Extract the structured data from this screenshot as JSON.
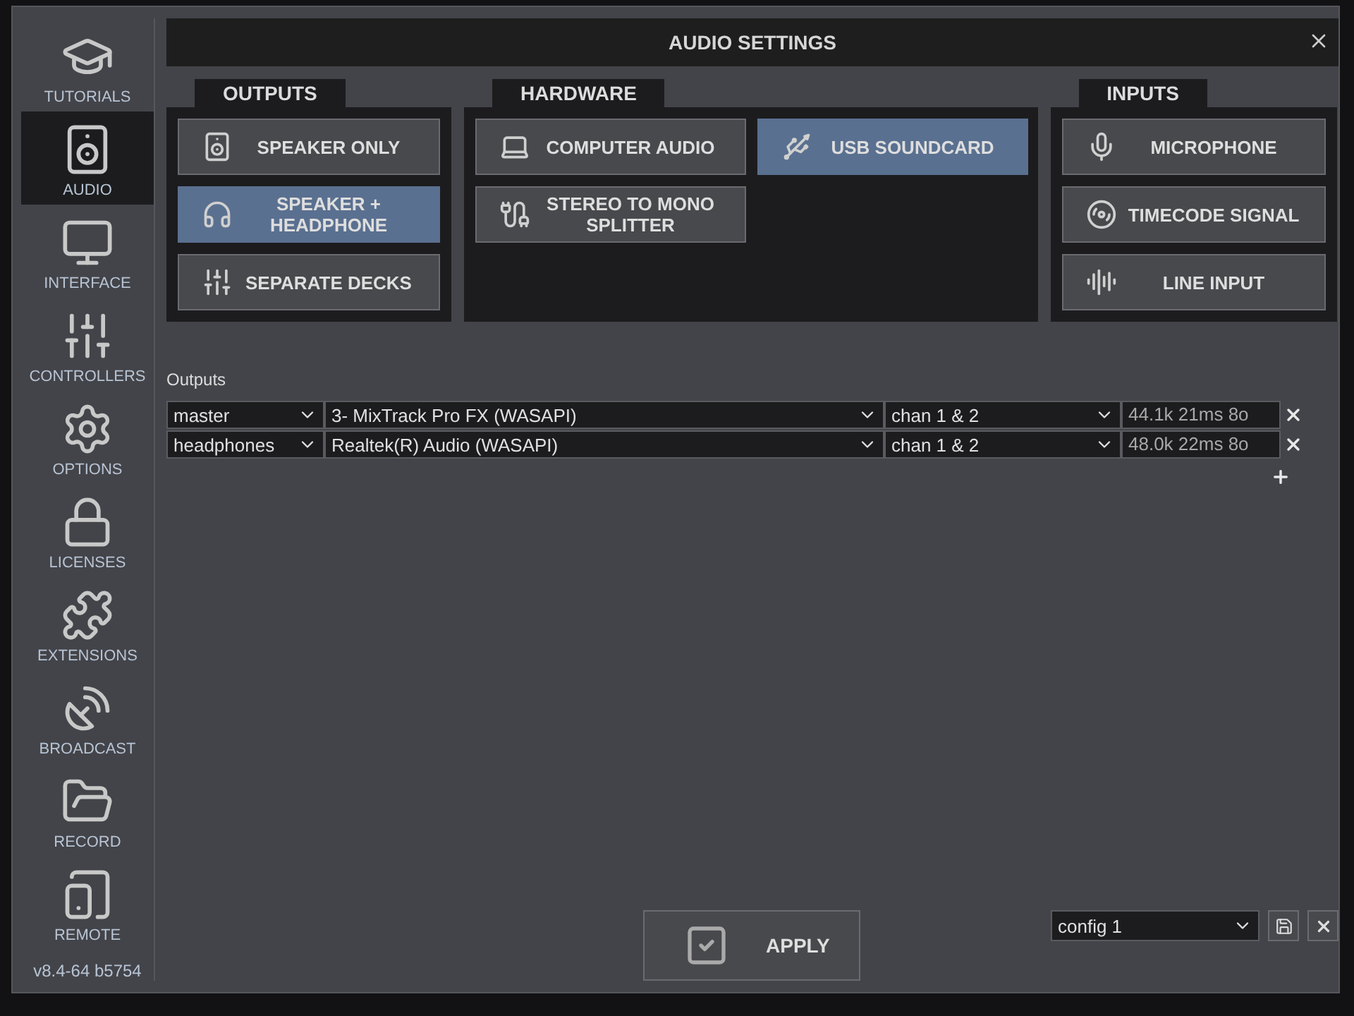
{
  "sidebar": {
    "items": [
      {
        "label": "TUTORIALS",
        "selected": false
      },
      {
        "label": "AUDIO",
        "selected": true
      },
      {
        "label": "INTERFACE",
        "selected": false
      },
      {
        "label": "CONTROLLERS",
        "selected": false
      },
      {
        "label": "OPTIONS",
        "selected": false
      },
      {
        "label": "LICENSES",
        "selected": false
      },
      {
        "label": "EXTENSIONS",
        "selected": false
      },
      {
        "label": "BROADCAST",
        "selected": false
      },
      {
        "label": "RECORD",
        "selected": false
      },
      {
        "label": "REMOTE",
        "selected": false
      }
    ],
    "version": "v8.4-64 b5754"
  },
  "window": {
    "title": "AUDIO SETTINGS"
  },
  "sections": [
    {
      "title": "OUTPUTS",
      "buttons": [
        {
          "label": "SPEAKER ONLY",
          "selected": false
        },
        {
          "label": "SPEAKER + HEADPHONE",
          "selected": true
        },
        {
          "label": "SEPARATE DECKS",
          "selected": false
        }
      ]
    },
    {
      "title": "HARDWARE",
      "buttons": [
        {
          "label": "COMPUTER AUDIO",
          "selected": false
        },
        {
          "label": "USB SOUNDCARD",
          "selected": true
        },
        {
          "label": "STEREO TO MONO SPLITTER",
          "selected": false
        }
      ]
    },
    {
      "title": "INPUTS",
      "buttons": [
        {
          "label": "MICROPHONE",
          "selected": false
        },
        {
          "label": "TIMECODE SIGNAL",
          "selected": false
        },
        {
          "label": "LINE INPUT",
          "selected": false
        }
      ]
    }
  ],
  "outputs": {
    "label": "Outputs",
    "rows": [
      {
        "channel": "master",
        "device": "3- MixTrack Pro FX (WASAPI)",
        "chans": "chan 1 & 2",
        "info": "44.1k 21ms 8o"
      },
      {
        "channel": "headphones",
        "device": "Realtek(R) Audio (WASAPI)",
        "chans": "chan 1 & 2",
        "info": "48.0k 22ms 8o"
      }
    ]
  },
  "apply": "APPLY",
  "config": {
    "value": "config 1"
  }
}
